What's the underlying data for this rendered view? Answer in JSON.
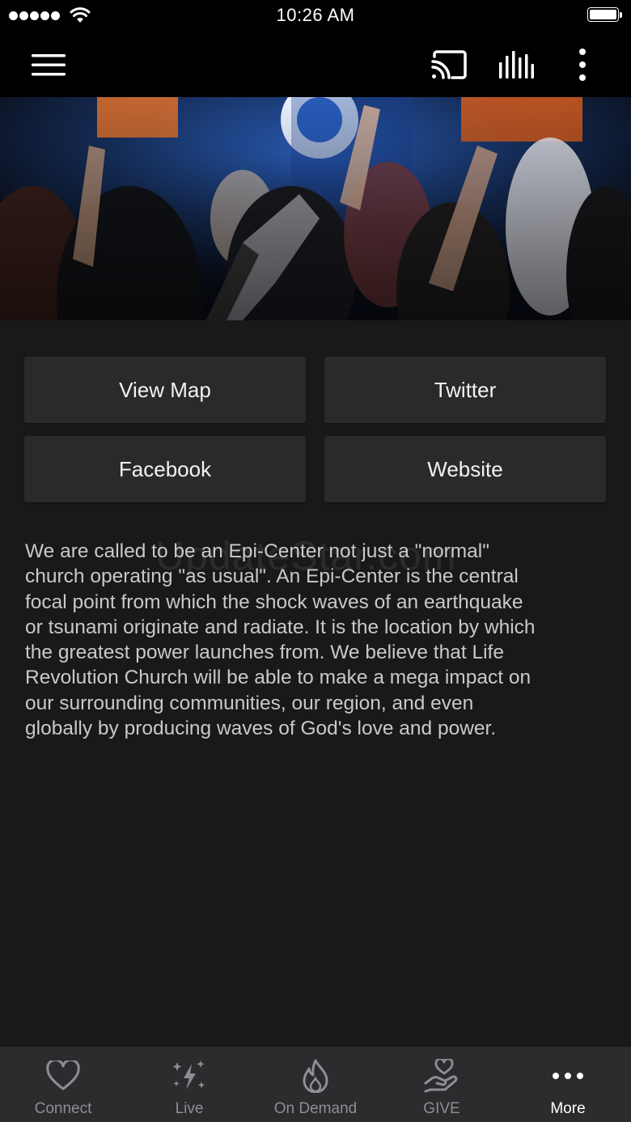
{
  "status_bar": {
    "time": "10:26 AM",
    "signal_bars": 5,
    "battery_level": 1.0
  },
  "nav": {
    "icons": [
      "menu-icon",
      "cast-icon",
      "audio-bars-icon",
      "more-vertical-icon"
    ]
  },
  "hero": {
    "image_subject": "worship-crowd-raised-hands"
  },
  "buttons": {
    "view_map": "View Map",
    "twitter": "Twitter",
    "facebook": "Facebook",
    "website": "Website"
  },
  "description": "We are called to be an Epi-Center not just a \"normal\"\nchurch operating \"as usual\". An Epi-Center is the central\nfocal point from which the shock waves of an earthquake\nor tsunami originate and radiate. It is the location by which\nthe greatest power launches from.  We believe that Life\nRevolution Church will be able to make a mega impact on\nour surrounding communities, our region, and even\nglobally by producing waves of God's love and power.",
  "watermark": "UpdateStar.com",
  "tabs": [
    {
      "label": "Connect",
      "icon": "heart-icon",
      "active": false
    },
    {
      "label": "Live",
      "icon": "sparkle-lightning-icon",
      "active": false
    },
    {
      "label": "On Demand",
      "icon": "flame-icon",
      "active": false
    },
    {
      "label": "GIVE",
      "icon": "heart-hand-icon",
      "active": false
    },
    {
      "label": "More",
      "icon": "ellipsis-icon",
      "active": true
    }
  ],
  "colors": {
    "background": "#19191b",
    "button": "#2a2a2c",
    "tab_bar": "#2c2c2e",
    "tab_inactive": "#8e8e93",
    "tab_active": "#ffffff",
    "text": "#c9c9c9"
  }
}
